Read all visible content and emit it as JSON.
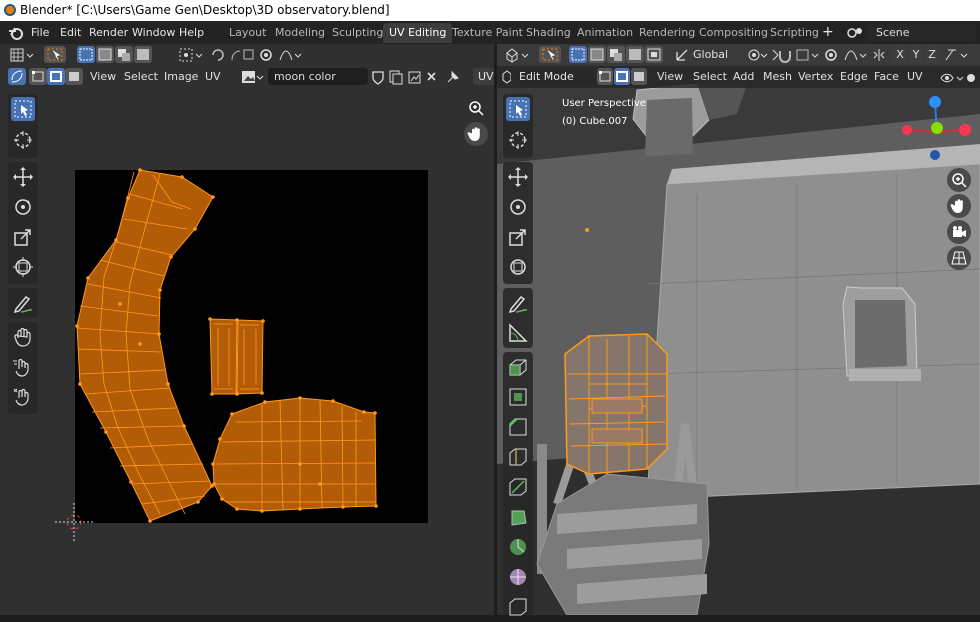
{
  "window": {
    "title": "Blender* [C:\\Users\\Game Gen\\Desktop\\3D observatory.blend]"
  },
  "menubar": {
    "items": [
      "File",
      "Edit",
      "Render",
      "Window",
      "Help"
    ]
  },
  "workspaces": {
    "tabs": [
      "Layout",
      "Modeling",
      "Sculpting",
      "UV Editing",
      "Texture Paint",
      "Shading",
      "Animation",
      "Rendering",
      "Compositing",
      "Scripting"
    ],
    "active": "UV Editing",
    "add_label": "+"
  },
  "scene": {
    "label": "Scene"
  },
  "uv_editor": {
    "header_menu": [
      "View",
      "Select",
      "Image",
      "UV"
    ],
    "image_name": "moon color",
    "uv_tab": "UV"
  },
  "viewport": {
    "header_menu": [
      "View",
      "Select",
      "Add",
      "Mesh",
      "Vertex",
      "Edge",
      "Face",
      "UV"
    ],
    "mode": "Edit Mode",
    "transform_orientation": "Global",
    "axis_x": "X",
    "axis_y": "Y",
    "axis_z": "Z",
    "perspective_label": "User Perspective",
    "object_label": "(0) Cube.007"
  },
  "colors": {
    "accent": "#4772b3",
    "uv_fill": "#b35c08",
    "uv_edge": "#ff9a1a",
    "title_bg": "#ffffff"
  }
}
